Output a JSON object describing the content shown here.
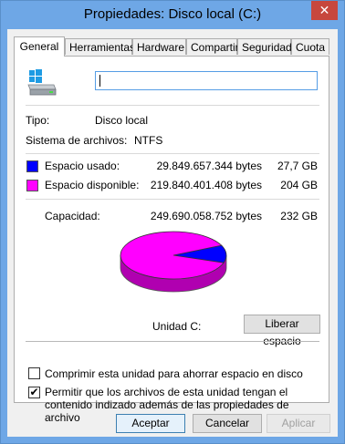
{
  "window": {
    "title": "Propiedades: Disco local (C:)",
    "close_glyph": "✕"
  },
  "tabs": [
    {
      "label": "General",
      "active": true
    },
    {
      "label": "Herramientas",
      "active": false
    },
    {
      "label": "Hardware",
      "active": false
    },
    {
      "label": "Compartir",
      "active": false
    },
    {
      "label": "Seguridad",
      "active": false
    },
    {
      "label": "Cuota",
      "active": false
    }
  ],
  "general": {
    "drive_icon": "drive-icon",
    "volume_name_value": "",
    "type_label": "Tipo:",
    "type_value": "Disco local",
    "fs_label": "Sistema de archivos:",
    "fs_value": "NTFS",
    "used": {
      "label": "Espacio usado:",
      "bytes": "29.849.657.344 bytes",
      "size": "27,7 GB",
      "color": "#0000ff"
    },
    "free": {
      "label": "Espacio disponible:",
      "bytes": "219.840.401.408 bytes",
      "size": "204 GB",
      "color": "#ff00ff"
    },
    "capacity": {
      "label": "Capacidad:",
      "bytes": "249.690.058.752 bytes",
      "size": "232 GB"
    },
    "used_fraction": 0.1195,
    "drive_label": "Unidad C:",
    "cleanup_button": "Liberar espacio",
    "compress_label": "Comprimir esta unidad para ahorrar espacio en disco",
    "compress_checked": false,
    "index_label": "Permitir que los archivos de esta unidad tengan el contenido indizado además de las propiedades de archivo",
    "index_checked": true
  },
  "buttons": {
    "ok": "Aceptar",
    "cancel": "Cancelar",
    "apply": "Aplicar"
  },
  "check_glyph": "✔"
}
